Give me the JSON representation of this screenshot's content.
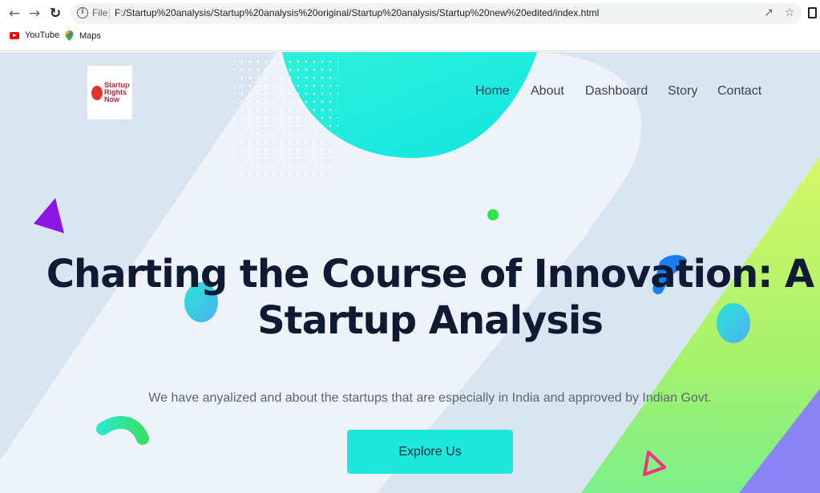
{
  "browser": {
    "url_scheme": "File",
    "url": "F:/Startup%20analysis/Startup%20analysis%20original/Startup%20analysis/Startup%20new%20edited/index.html",
    "bookmarks": [
      {
        "label": "YouTube",
        "icon": "youtube-icon"
      },
      {
        "label": "Maps",
        "icon": "maps-icon"
      }
    ]
  },
  "site": {
    "logo_text": "Startup Rights Now",
    "nav": {
      "home": "Home",
      "about": "About",
      "dashboard": "Dashboard",
      "story": "Story",
      "contact": "Contact"
    },
    "hero": {
      "title_line1": "Charting the Course of Innovation: A",
      "title_line2": "Startup Analysis",
      "subtitle": "We have anyalized and about the startups that are especially in India and approved by Indian Govt.",
      "cta_label": "Explore Us"
    }
  },
  "colors": {
    "page_bg": "#d9e6f2",
    "accent": "#1ee8dc",
    "title": "#111a33",
    "lime": "#b4f36c",
    "purple": "#8a84f7"
  }
}
